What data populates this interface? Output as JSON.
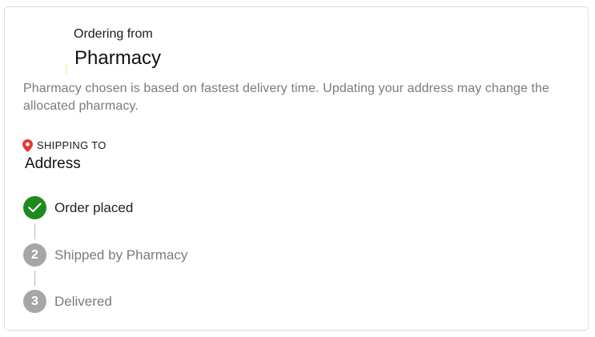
{
  "header": {
    "ordering_label": "Ordering from",
    "pharmacy_name": "Pharmacy"
  },
  "info": {
    "message": "Pharmacy chosen is based on fastest delivery time. Updating your address may change the allocated pharmacy."
  },
  "shipping": {
    "icon": "location-pin-icon",
    "label": "SHIPPING TO",
    "address": "Address"
  },
  "steps": [
    {
      "marker": "",
      "label": "Order placed",
      "status": "complete"
    },
    {
      "marker": "2",
      "label": "Shipped by Pharmacy",
      "status": "pending"
    },
    {
      "marker": "3",
      "label": "Delivered",
      "status": "pending"
    }
  ],
  "colors": {
    "complete": "#1e8a1e",
    "pending": "#a6a6a6",
    "pin": "#e53935"
  }
}
